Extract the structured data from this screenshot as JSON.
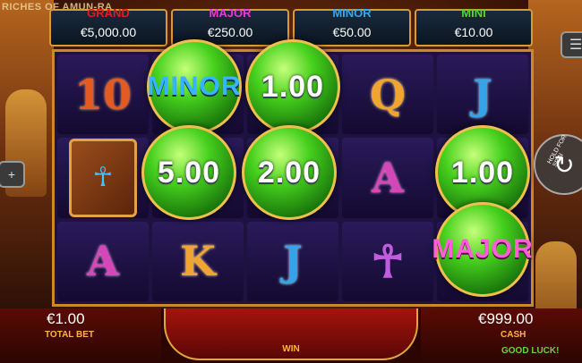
{
  "game_title": "RICHES OF AMUN-RA",
  "jackpots": [
    {
      "label": "GRAND",
      "value": "€5,000.00",
      "color": "#e51a1a"
    },
    {
      "label": "MAJOR",
      "value": "€250.00",
      "color": "#e83ad4"
    },
    {
      "label": "MINOR",
      "value": "€50.00",
      "color": "#36a7f0"
    },
    {
      "label": "MINI",
      "value": "€10.00",
      "color": "#5bd42a"
    }
  ],
  "reels": {
    "symbols": [
      [
        "10",
        "book",
        "A"
      ],
      [
        "MINOR",
        "5.00",
        "K"
      ],
      [
        "1.00",
        "2.00",
        "J"
      ],
      [
        "Q",
        "A",
        "ankh"
      ],
      [
        "J",
        "1.00",
        "MAJOR"
      ]
    ],
    "orbs": [
      {
        "reel": 1,
        "row": 0,
        "text": "MINOR"
      },
      {
        "reel": 2,
        "row": 0,
        "text": "1.00"
      },
      {
        "reel": 1,
        "row": 1,
        "text": "5.00"
      },
      {
        "reel": 2,
        "row": 1,
        "text": "2.00"
      },
      {
        "reel": 4,
        "row": 1,
        "text": "1.00"
      },
      {
        "reel": 4,
        "row": 2,
        "text": "MAJOR"
      }
    ]
  },
  "bottom_bar": {
    "total_bet_value": "€1.00",
    "total_bet_label": "TOTAL BET",
    "win_label": "WIN",
    "cash_value": "€999.00",
    "cash_label": "CASH",
    "status": "GOOD LUCK!"
  },
  "controls": {
    "hold_for_spin": "HOLD FOR SPIN",
    "menu_icon": "hamburger-menu-icon",
    "spin_icon": "spin-arrow-icon",
    "zoom_icon": "plus-icon"
  }
}
